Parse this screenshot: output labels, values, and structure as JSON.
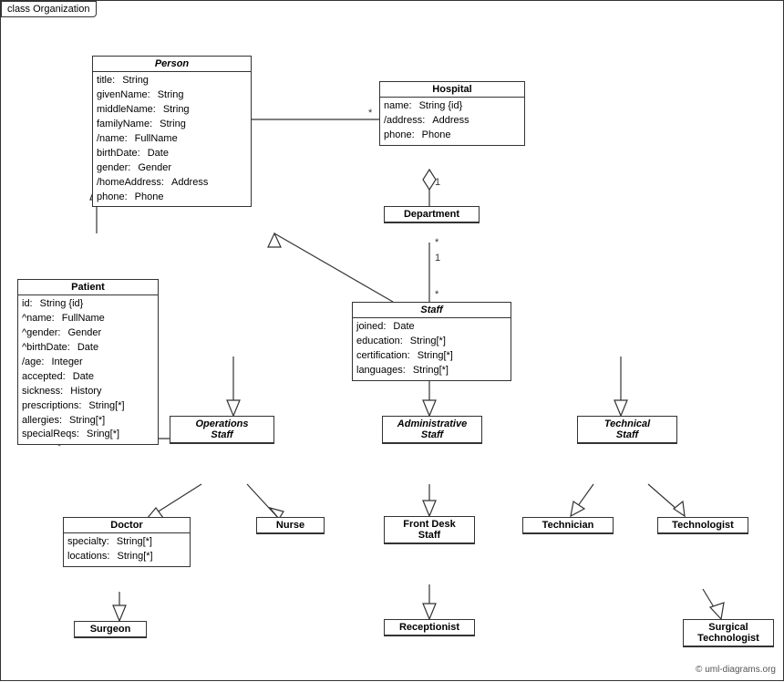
{
  "diagram": {
    "title": "class Organization",
    "classes": {
      "person": {
        "name": "Person",
        "italic": true,
        "attrs": [
          {
            "name": "title:",
            "type": "String"
          },
          {
            "name": "givenName:",
            "type": "String"
          },
          {
            "name": "middleName:",
            "type": "String"
          },
          {
            "name": "familyName:",
            "type": "String"
          },
          {
            "name": "/name:",
            "type": "FullName"
          },
          {
            "name": "birthDate:",
            "type": "Date"
          },
          {
            "name": "gender:",
            "type": "Gender"
          },
          {
            "name": "/homeAddress:",
            "type": "Address"
          },
          {
            "name": "phone:",
            "type": "Phone"
          }
        ]
      },
      "hospital": {
        "name": "Hospital",
        "italic": false,
        "attrs": [
          {
            "name": "name:",
            "type": "String {id}"
          },
          {
            "name": "/address:",
            "type": "Address"
          },
          {
            "name": "phone:",
            "type": "Phone"
          }
        ]
      },
      "department": {
        "name": "Department",
        "italic": false,
        "attrs": []
      },
      "staff": {
        "name": "Staff",
        "italic": true,
        "attrs": [
          {
            "name": "joined:",
            "type": "Date"
          },
          {
            "name": "education:",
            "type": "String[*]"
          },
          {
            "name": "certification:",
            "type": "String[*]"
          },
          {
            "name": "languages:",
            "type": "String[*]"
          }
        ]
      },
      "patient": {
        "name": "Patient",
        "italic": false,
        "attrs": [
          {
            "name": "id:",
            "type": "String {id}"
          },
          {
            "name": "^name:",
            "type": "FullName"
          },
          {
            "name": "^gender:",
            "type": "Gender"
          },
          {
            "name": "^birthDate:",
            "type": "Date"
          },
          {
            "name": "/age:",
            "type": "Integer"
          },
          {
            "name": "accepted:",
            "type": "Date"
          },
          {
            "name": "sickness:",
            "type": "History"
          },
          {
            "name": "prescriptions:",
            "type": "String[*]"
          },
          {
            "name": "allergies:",
            "type": "String[*]"
          },
          {
            "name": "specialReqs:",
            "type": "Sring[*]"
          }
        ]
      },
      "ops_staff": {
        "name": "Operations\nStaff",
        "italic": true,
        "attrs": []
      },
      "admin_staff": {
        "name": "Administrative\nStaff",
        "italic": true,
        "attrs": []
      },
      "tech_staff": {
        "name": "Technical\nStaff",
        "italic": true,
        "attrs": []
      },
      "doctor": {
        "name": "Doctor",
        "italic": false,
        "attrs": [
          {
            "name": "specialty:",
            "type": "String[*]"
          },
          {
            "name": "locations:",
            "type": "String[*]"
          }
        ]
      },
      "nurse": {
        "name": "Nurse",
        "italic": false,
        "attrs": []
      },
      "front_desk": {
        "name": "Front Desk\nStaff",
        "italic": false,
        "attrs": []
      },
      "technician": {
        "name": "Technician",
        "italic": false,
        "attrs": []
      },
      "technologist": {
        "name": "Technologist",
        "italic": false,
        "attrs": []
      },
      "surgeon": {
        "name": "Surgeon",
        "italic": false,
        "attrs": []
      },
      "receptionist": {
        "name": "Receptionist",
        "italic": false,
        "attrs": []
      },
      "surgical_tech": {
        "name": "Surgical\nTechnologist",
        "italic": false,
        "attrs": []
      }
    },
    "copyright": "© uml-diagrams.org"
  }
}
